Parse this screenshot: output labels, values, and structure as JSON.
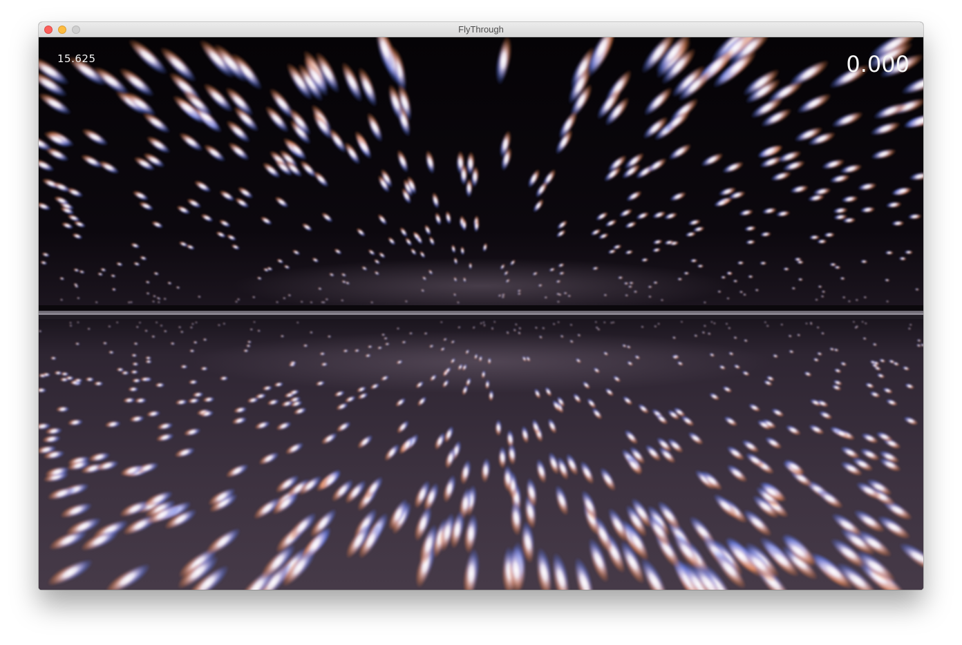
{
  "window": {
    "title": "FlyThrough"
  },
  "hud": {
    "left_readout": "15.625",
    "right_readout": "0.000"
  },
  "scene": {
    "sky_color": "#050306",
    "floor_color": "#3f3441",
    "horizon_color": "#8a8590",
    "light_core_color": "#fffafa",
    "light_warm_color": "#ff9a5a",
    "light_cool_color": "#7d9cff"
  }
}
